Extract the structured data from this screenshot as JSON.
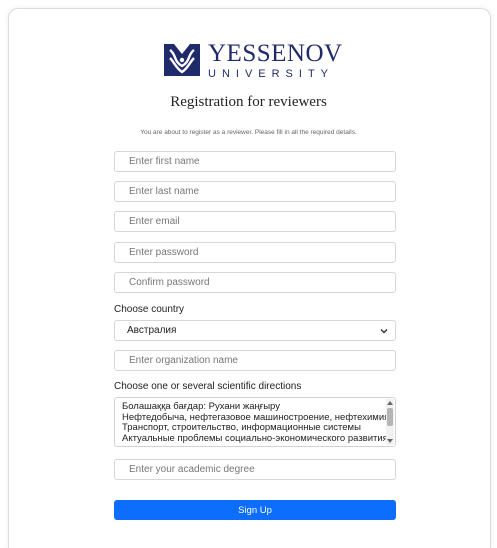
{
  "logo": {
    "name": "YESSENOV",
    "sub": "UNIVERSITY",
    "color": "#1f2a6b"
  },
  "title": "Registration for reviewers",
  "intro": "You are about to register as a reviewer. Please fill in all the required details.",
  "fields": {
    "first_name": "Enter first name",
    "last_name": "Enter last name",
    "email": "Enter email",
    "password": "Enter password",
    "confirm_password": "Confirm password",
    "organization": "Enter organization name",
    "degree": "Enter your academic degree"
  },
  "country": {
    "label": "Choose country",
    "selected": "Австралия"
  },
  "directions": {
    "label": "Choose one or several scientific directions",
    "options": [
      "Болашаққа бағдар: Рухани жаңғыру",
      "Нефтедобыча, нефтегазовое машиностроение, нефтехимия",
      "Транспорт, строительство, информационные системы",
      "Актуальные проблемы социально-экономического развития"
    ]
  },
  "signup": "Sign Up",
  "colors": {
    "primary": "#0d6efd",
    "border": "#d3d6da"
  }
}
